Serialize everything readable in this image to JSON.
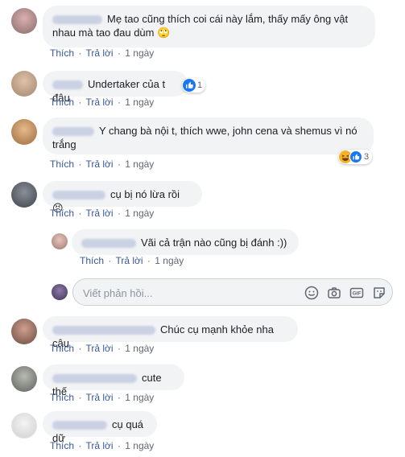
{
  "actions": {
    "like": "Thích",
    "reply": "Trả lời",
    "separator": "·"
  },
  "comments": [
    {
      "text": "Mẹ tao cũng thích coi cái này lắm, thấy mấy ông vật nhau mà tao đau dùm 🙄",
      "time": "1 ngày"
    },
    {
      "text": "Undertaker của t đâu",
      "time": "1 ngày",
      "reaction_count": "1"
    },
    {
      "text": "Y chang bà nội t, thích wwe, john cena và shemus vì nó trắng",
      "time": "1 ngày",
      "reaction_count": "3"
    },
    {
      "text": "cụ bị nó lừa rồi 😣",
      "time": "1 ngày"
    },
    {
      "text": "Vãi cả trận nào cũng bị đánh :))",
      "time": "1 ngày"
    },
    {
      "text": "Chúc cụ mạnh khỏe nha cậu",
      "time": "1 ngày"
    },
    {
      "text": "cute thế",
      "time": "1 ngày"
    },
    {
      "text": "cụ quá dữ",
      "time": "1 ngày"
    }
  ],
  "reply_box": {
    "placeholder": "Viết phản hồi..."
  },
  "icons": [
    "emoji-icon",
    "camera-icon",
    "gif-icon",
    "sticker-icon",
    "like-reaction-icon",
    "haha-reaction-icon"
  ],
  "colors": {
    "link": "#385898",
    "bubble": "#f2f3f5",
    "like_blue": "#1877f2",
    "haha_yellow": "#f7b125"
  }
}
